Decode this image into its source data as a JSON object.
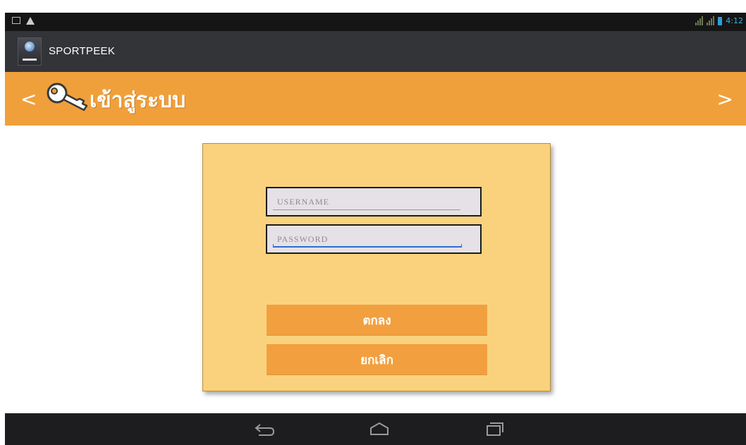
{
  "status_bar": {
    "time": "4:12",
    "icons": [
      "screenshot-icon",
      "warning-icon",
      "signal-icon",
      "signal-icon",
      "battery-icon"
    ]
  },
  "action_bar": {
    "app_name": "SPORTPEEK",
    "app_icon": "sportpeek-logo-icon"
  },
  "header": {
    "prev_label": "<",
    "title": "เข้าสู่ระบบ",
    "next_label": ">",
    "icon": "key-icon",
    "color": "#f0a03b"
  },
  "login_form": {
    "username_placeholder": "USERNAME",
    "password_placeholder": "PASSWORD",
    "ok_label": "ตกลง",
    "cancel_label": "ยกเลิก",
    "panel_color": "#fad27d",
    "button_color": "#f2a03f"
  },
  "navigation": {
    "buttons": [
      "back-icon",
      "home-icon",
      "recent-apps-icon"
    ]
  }
}
